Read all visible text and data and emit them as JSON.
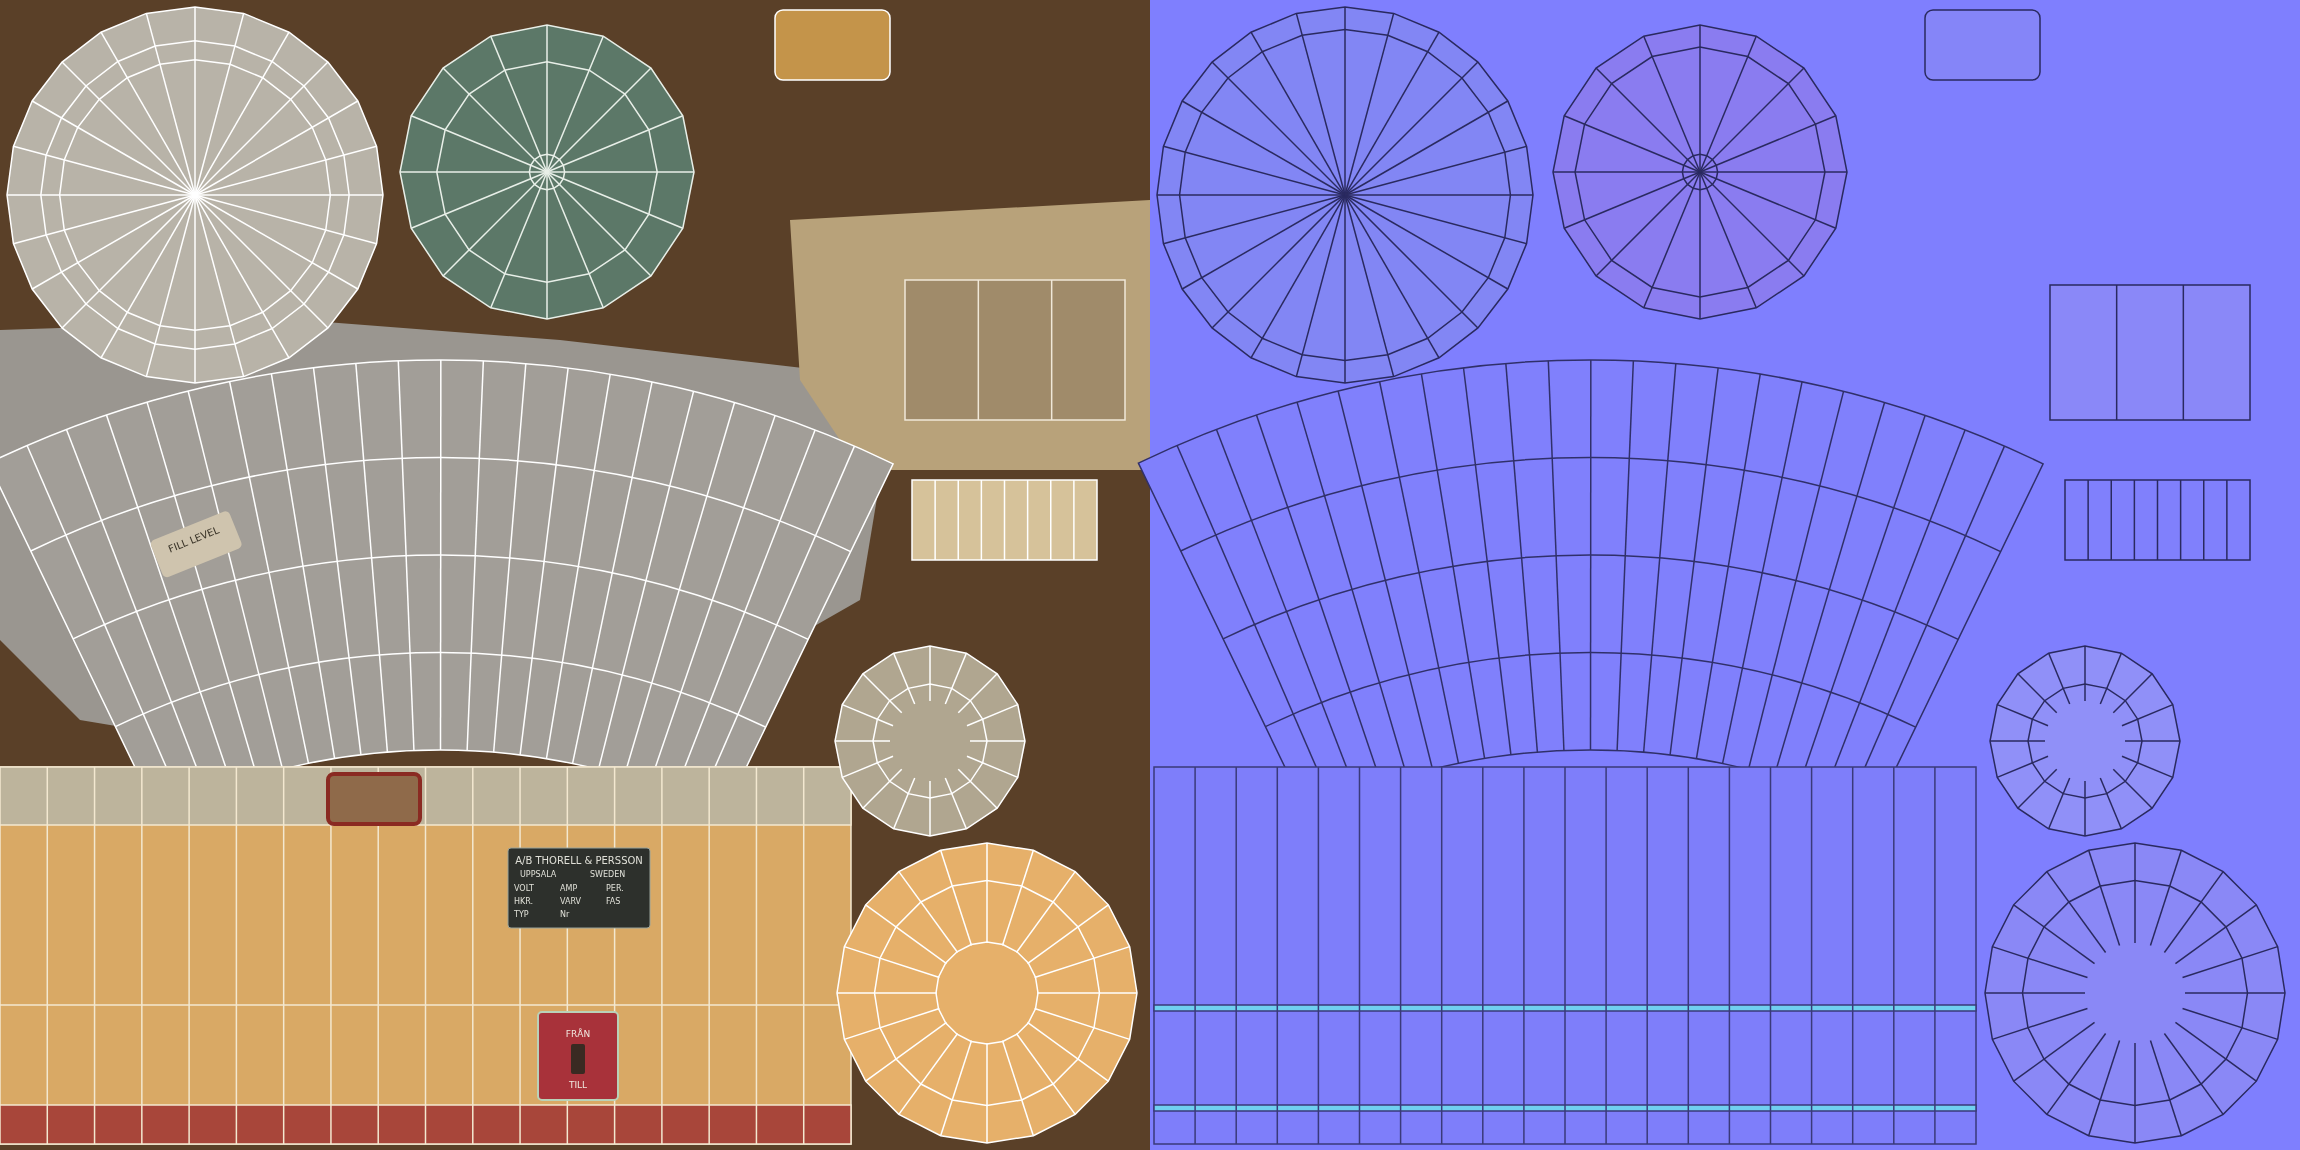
{
  "diffuse_map": {
    "nameplate": {
      "brand": "A/B THORELL & PERSSON",
      "city": "UPPSALA",
      "country": "SWEDEN",
      "fields": [
        "VOLT",
        "AMP",
        "PER.",
        "HKR.",
        "VARV",
        "FAS",
        "TYP",
        "Nr"
      ]
    },
    "switch_plate": {
      "top_label": "FRÅN",
      "bottom_label": "TILL"
    },
    "sticker": {
      "label": "FILL LEVEL"
    }
  }
}
